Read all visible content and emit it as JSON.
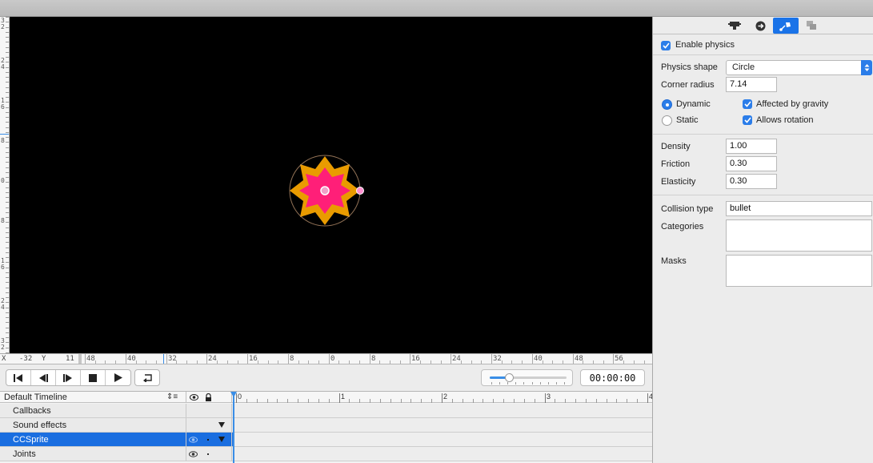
{
  "rulers": {
    "vertical_labels": [
      "3\n2",
      "2\n4",
      "1\n6",
      "8",
      "0",
      "8",
      "1\n6",
      "2\n4",
      "3\n2"
    ],
    "x_label": "X",
    "x_value": "-32",
    "y_label": "Y",
    "y_value": "11",
    "horizontal_labels": [
      "48",
      "40",
      "32",
      "24",
      "16",
      "8",
      "0",
      "8",
      "16",
      "24",
      "32",
      "40",
      "48",
      "56",
      "6"
    ]
  },
  "playback": {
    "buttons": [
      "skip-to-start-icon",
      "step-back-icon",
      "step-forward-icon",
      "stop-icon",
      "play-icon"
    ],
    "loop_icon": "loop-icon",
    "zoom_fraction": 0.25,
    "timecode": "00:00:00"
  },
  "timeline": {
    "name": "Default Timeline",
    "selector_icon": "sort-list-icon",
    "eye_icon": "eye-icon",
    "lock_icon": "lock-icon",
    "ruler_labels": [
      "0",
      "1",
      "2",
      "3",
      "4"
    ],
    "rows": [
      {
        "label": "Callbacks",
        "selected": false,
        "eye": false,
        "dot": false,
        "arrow": false
      },
      {
        "label": "Sound effects",
        "selected": false,
        "eye": false,
        "dot": false,
        "arrow": true
      },
      {
        "label": "CCSprite",
        "selected": true,
        "eye": true,
        "dot": true,
        "arrow": true
      },
      {
        "label": "Joints",
        "selected": false,
        "eye": true,
        "dot": true,
        "arrow": false
      }
    ]
  },
  "inspector": {
    "tabs": [
      "node-properties-icon",
      "code-connections-icon",
      "physics-icon",
      "templates-icon"
    ],
    "active_tab": 2,
    "enable_physics": {
      "label": "Enable physics",
      "checked": true
    },
    "physics_shape": {
      "label": "Physics shape",
      "value": "Circle"
    },
    "corner_radius": {
      "label": "Corner radius",
      "value": "7.14"
    },
    "body_type": {
      "dynamic": "Dynamic",
      "static": "Static",
      "selected": "dynamic"
    },
    "affected_by_gravity": {
      "label": "Affected by gravity",
      "checked": true
    },
    "allows_rotation": {
      "label": "Allows rotation",
      "checked": true
    },
    "density": {
      "label": "Density",
      "value": "1.00"
    },
    "friction": {
      "label": "Friction",
      "value": "0.30"
    },
    "elasticity": {
      "label": "Elasticity",
      "value": "0.30"
    },
    "collision_type": {
      "label": "Collision type",
      "value": "bullet"
    },
    "categories": {
      "label": "Categories",
      "value": ""
    },
    "masks": {
      "label": "Masks",
      "value": ""
    }
  },
  "colors": {
    "accent": "#1a73e8",
    "canvas": "#000000",
    "sprite_outer": "#f5a300",
    "sprite_inner": "#ff1f78",
    "handle": "#ff8fd0"
  }
}
